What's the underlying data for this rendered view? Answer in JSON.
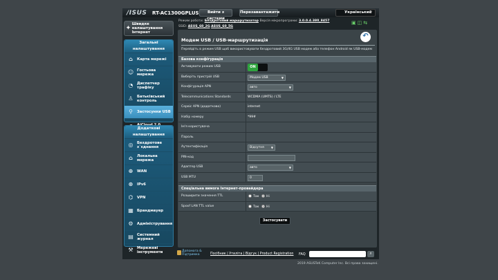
{
  "header": {
    "logo": "/ISUS",
    "model": "RT-AC1300GPLUS",
    "logout_label": "Вийти з системи",
    "reboot_label": "Перезавантажити",
    "language": "Український"
  },
  "status": {
    "mode_label": "Режим роботи:",
    "mode_value": "Бездротовий маршрутизатор",
    "fw_label": "Версія мікропрограми:",
    "fw_value": "3.0.0.4.380_8457",
    "ssid_label": "SSID:",
    "ssid1": "ASUS_60_2G",
    "ssid2": "ASUS_60_5G"
  },
  "sidebar": {
    "quick_setup": "Швидке налаштування Інтернет",
    "general_title": "Загальні налаштування",
    "general_items": [
      {
        "label": "Карта мережі",
        "icon": "network-map-icon"
      },
      {
        "label": "Гостьова мережа",
        "icon": "guest-network-icon"
      },
      {
        "label": "Диспетчер трафіку",
        "icon": "traffic-manager-icon"
      },
      {
        "label": "Батьківський контроль",
        "icon": "parental-control-icon"
      },
      {
        "label": "Застосунки USB",
        "icon": "usb-icon"
      },
      {
        "label": "AiCloud 2.0",
        "icon": "cloud-icon"
      }
    ],
    "advanced_title": "Додаткові налаштування",
    "advanced_items": [
      {
        "label": "Бездротове з`єднання",
        "icon": "wireless-icon"
      },
      {
        "label": "Локальна мережа",
        "icon": "lan-icon"
      },
      {
        "label": "WAN",
        "icon": "wan-icon"
      },
      {
        "label": "IPv6",
        "icon": "ipv6-icon"
      },
      {
        "label": "VPN",
        "icon": "vpn-icon"
      },
      {
        "label": "Брандмауер",
        "icon": "firewall-icon"
      },
      {
        "label": "Адміністрування",
        "icon": "admin-icon"
      },
      {
        "label": "Системний журнал",
        "icon": "syslog-icon"
      },
      {
        "label": "Мережеві інструменти",
        "icon": "tools-icon"
      }
    ]
  },
  "main": {
    "title": "Модем USB / USB-маршрутизація",
    "description": "Перейдіть в режим USB щоб використовувати бездротовий 3G/4G USB модем або телефон Android як USB-модем",
    "section_basic": "Базова конфігурація",
    "rows": {
      "enable_label": "Активувати режим USB",
      "enable_value": "ON",
      "device_label": "Виберіть пристрій USB",
      "device_value": "Модем USB",
      "apn_cfg_label": "Конфігурація APN",
      "apn_cfg_value": "авто",
      "telecom_label": "Telecommunications Standards",
      "telecom_value": "WCDMA (UMTS) / LTE",
      "apn_service_label": "Сервіс APN (додатково)",
      "apn_service_value": "internet",
      "dial_label": "Набір номеру",
      "dial_value": "*99#",
      "user_label": "Ім'я користувача",
      "user_value": "",
      "pass_label": "Пароль",
      "pass_value": "",
      "auth_label": "Аутентифікація",
      "auth_value": "Відсутня",
      "pin_label": "PIN-код",
      "pin_value": "",
      "adapter_label": "Адаптер USB",
      "adapter_value": "авто",
      "mtu_label": "USB MTU",
      "mtu_value": "0"
    },
    "section_special": "Спеціальна вимога Інтернет-провайдера",
    "ttl_label": "Розширити значення TTL",
    "spoof_label": "Spoof LAN TTL value",
    "yes": "Так",
    "no": "Ні",
    "apply": "Застосувати"
  },
  "footer": {
    "help": "Допомога & Підтримка",
    "links": "Посібник | Утиліта | Відгук | Product Registration",
    "faq": "FAQ",
    "copyright": "2019 ASUSTeK Computer Inc. Всі права захищені."
  },
  "colors": {
    "accent": "#3a8fbd",
    "toggle_on": "#2fa43e"
  }
}
